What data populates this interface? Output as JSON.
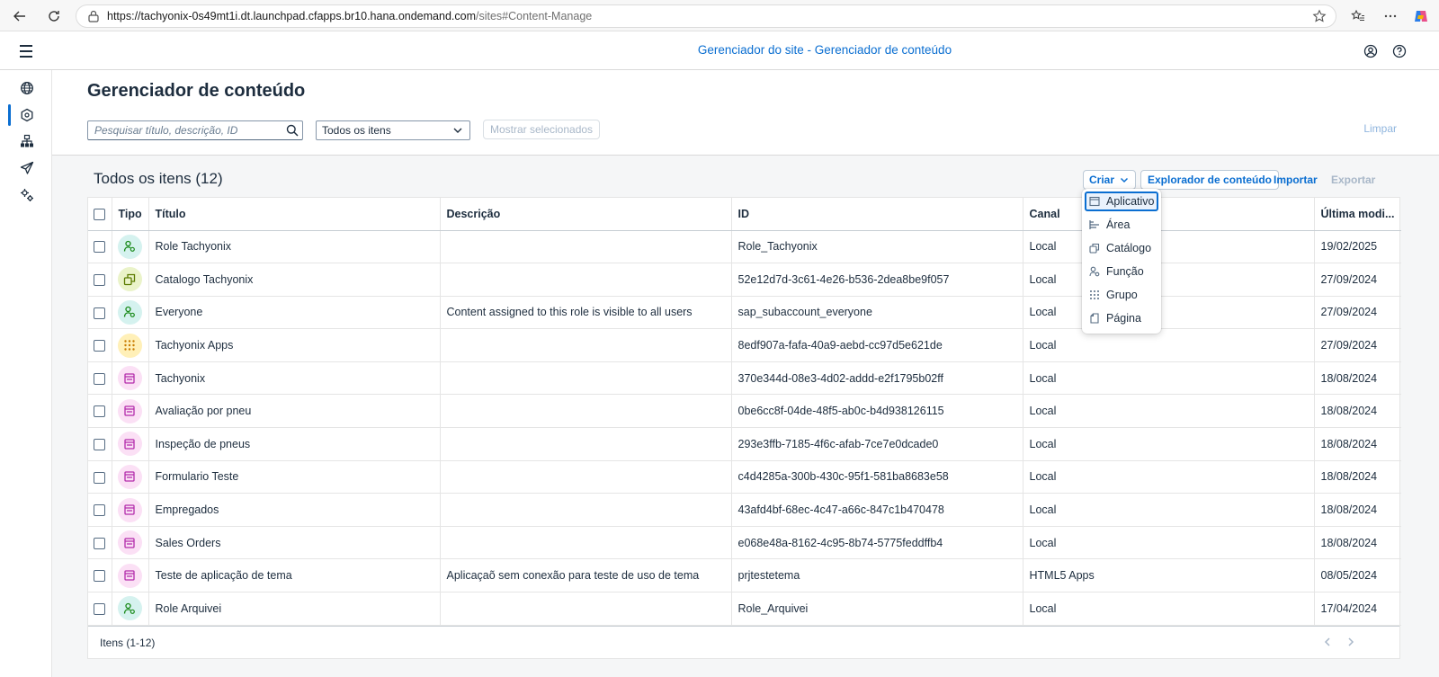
{
  "browser": {
    "url_domain": "https://tachyonix-0s49mt1i.dt.launchpad.cfapps.br10.hana.ondemand.com",
    "url_path": "/sites#Content-Manage"
  },
  "shell": {
    "title": "Gerenciador do site - Gerenciador de conteúdo"
  },
  "header": {
    "title": "Gerenciador de conteúdo",
    "search_placeholder": "Pesquisar título, descrição, ID",
    "filter_selected": "Todos os itens",
    "show_selected_label": "Mostrar selecionados",
    "clear_label": "Limpar"
  },
  "toolbar": {
    "title": "Todos os itens (12)",
    "create_label": "Criar",
    "explorer_label": "Explorador de conteúdo",
    "import_label": "Importar",
    "export_label": "Exportar"
  },
  "create_menu": {
    "items": [
      {
        "label": "Aplicativo",
        "icon": "app-icon"
      },
      {
        "label": "Área",
        "icon": "area-icon"
      },
      {
        "label": "Catálogo",
        "icon": "catalog-icon"
      },
      {
        "label": "Função",
        "icon": "role-icon"
      },
      {
        "label": "Grupo",
        "icon": "group-icon"
      },
      {
        "label": "Página",
        "icon": "page-icon"
      }
    ]
  },
  "table": {
    "columns": [
      "Tipo",
      "Título",
      "Descrição",
      "ID",
      "Canal",
      "Última modi..."
    ],
    "rows": [
      {
        "type": "role",
        "title": "Role Tachyonix",
        "description": "",
        "id": "Role_Tachyonix",
        "channel": "Local",
        "modified": "19/02/2025"
      },
      {
        "type": "catalog",
        "title": "Catalogo Tachyonix",
        "description": "",
        "id": "52e12d7d-3c61-4e26-b536-2dea8be9f057",
        "channel": "Local",
        "modified": "27/09/2024"
      },
      {
        "type": "role",
        "title": "Everyone",
        "description": "Content assigned to this role is visible to all users",
        "id": "sap_subaccount_everyone",
        "channel": "Local",
        "modified": "27/09/2024"
      },
      {
        "type": "group",
        "title": "Tachyonix Apps",
        "description": "",
        "id": "8edf907a-fafa-40a9-aebd-cc97d5e621de",
        "channel": "Local",
        "modified": "27/09/2024"
      },
      {
        "type": "app",
        "title": "Tachyonix",
        "description": "",
        "id": "370e344d-08e3-4d02-addd-e2f1795b02ff",
        "channel": "Local",
        "modified": "18/08/2024"
      },
      {
        "type": "app",
        "title": "Avaliação por pneu",
        "description": "",
        "id": "0be6cc8f-04de-48f5-ab0c-b4d938126115",
        "channel": "Local",
        "modified": "18/08/2024"
      },
      {
        "type": "app",
        "title": "Inspeção de pneus",
        "description": "",
        "id": "293e3ffb-7185-4f6c-afab-7ce7e0dcade0",
        "channel": "Local",
        "modified": "18/08/2024"
      },
      {
        "type": "app",
        "title": "Formulario Teste",
        "description": "",
        "id": "c4d4285a-300b-430c-95f1-581ba8683e58",
        "channel": "Local",
        "modified": "18/08/2024"
      },
      {
        "type": "app",
        "title": "Empregados",
        "description": "",
        "id": "43afd4bf-68ec-4c47-a66c-847c1b470478",
        "channel": "Local",
        "modified": "18/08/2024"
      },
      {
        "type": "app",
        "title": "Sales Orders",
        "description": "",
        "id": "e068e48a-8162-4c95-8b74-5775feddffb4",
        "channel": "Local",
        "modified": "18/08/2024"
      },
      {
        "type": "app",
        "title": "Teste de aplicação de tema",
        "description": "Aplicaçaõ sem conexão para teste de uso de tema",
        "id": "prjtestetema",
        "channel": "HTML5 Apps",
        "modified": "08/05/2024"
      },
      {
        "type": "role",
        "title": "Role Arquivei",
        "description": "",
        "id": "Role_Arquivei",
        "channel": "Local",
        "modified": "17/04/2024"
      }
    ],
    "footer": "Itens (1-12)"
  },
  "colors": {
    "accent": "#0a6ed1",
    "role_bg": "#d5f2ef",
    "role_fg": "#188918",
    "catalog_bg": "#eaf3c9",
    "catalog_fg": "#5b7b00",
    "group_bg": "#fff0b8",
    "group_fg": "#c87b00",
    "app_bg": "#fbe0f5",
    "app_fg": "#b32bab"
  }
}
